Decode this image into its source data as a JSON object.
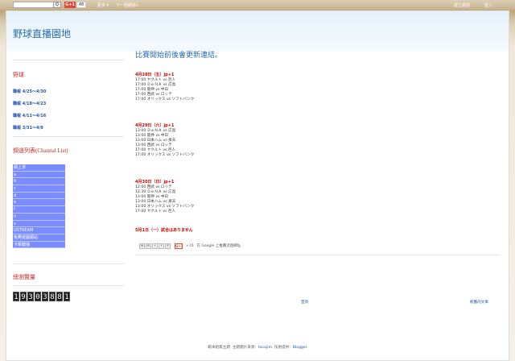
{
  "navbar": {
    "search_button": "Q",
    "gplus": "G+1",
    "gplus_count": "48",
    "more": "更多 ▾",
    "next_blog": "下一個網誌»",
    "create_blog": "建立網誌",
    "login": "登入"
  },
  "blog_title": "野球直播園地",
  "sidebar": {
    "baseball_title": "野球",
    "links": [
      "職報 4/25〜4/30",
      "職報 4/18〜4/23",
      "職報 4/11〜4/16",
      "職報 3/31〜4/9"
    ],
    "channel_title": "頻道列表(Channal List)",
    "channels": [
      "網上求",
      "a",
      "b",
      "c",
      "d",
      "e",
      "f",
      "h",
      "v",
      "USTREAM",
      "免費遊戲網站",
      "卡擊聽播"
    ],
    "pageviews_title": "總瀏覽量",
    "pageviews_digits": [
      "1",
      "9",
      "3",
      "0",
      "3",
      "8",
      "8",
      "1"
    ]
  },
  "post": {
    "title": "比賽開始前後會更新連結。",
    "days": [
      {
        "heading": "4月28日（五）",
        "tag": "jp+1",
        "games": [
          "17:00 ヤクルト vs 巨人",
          "17:00 ＤｅＮＡ vs 広島",
          "17:00 阪神 vs 中日",
          "17:00 西武 vs ロッテ",
          "17:00 オリックス vs ソフトバンク"
        ]
      },
      {
        "heading": "4月29日（六）",
        "tag": "jp+1",
        "games": [
          "13:00 ＤｅＮＡ vs 広島",
          "13:00 阪神 vs 中日",
          "13:00 日本ハム vs 楽天",
          "13:00 西武 vs ロッテ",
          "17:00 ヤクルト vs 巨人",
          "17:00 オリックス vs ソフトバンク"
        ]
      },
      {
        "heading": "4月30日（日）",
        "tag": "jp+1",
        "games": [
          "12:00 西武 vs ロッテ",
          "12:30 ＤｅＮＡ vs 広島",
          "13:00 阪神 vs 中日",
          "13:00 日本ハム vs 楽天",
          "13:00 オリックス vs ソフトバンク",
          "17:00 ヤクルト vs 巨人"
        ]
      }
    ],
    "note": "5月1日（一）試合はありません",
    "share_icons": [
      "M",
      "B",
      "t",
      "f",
      "P"
    ],
    "gplus": "G+1",
    "gplus_count": "+16",
    "gplus_text": "在 Google 上推薦這個網址"
  },
  "pager": {
    "home": "首頁",
    "older": "較舊的文章"
  },
  "footer": {
    "prefix": "範本組無主題. 主題圖片來源：",
    "author": "tacojim",
    "mid": ". 技術提供：",
    "powered": "Blogger"
  }
}
